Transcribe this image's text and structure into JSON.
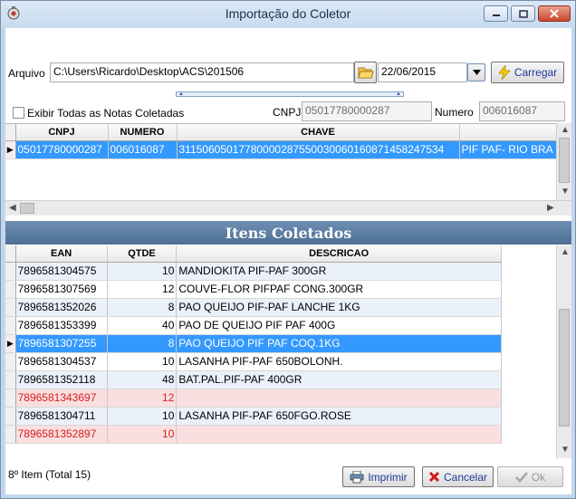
{
  "window": {
    "title": "Importação do Coletor"
  },
  "form": {
    "arquivo_label": "Arquivo",
    "arquivo_value": "C:\\Users\\Ricardo\\Desktop\\ACS\\201506",
    "date_value": "22/06/2015",
    "carregar_label": "Carregar",
    "exibir_label": "Exibir Todas as Notas Coletadas",
    "cnpj_label": "CNPJ",
    "cnpj_value": "05017780000287",
    "numero_label": "Numero",
    "numero_value": "006016087"
  },
  "notas_grid": {
    "columns": [
      "CNPJ",
      "NUMERO",
      "CHAVE",
      ""
    ],
    "rows": [
      [
        "05017780000287",
        "006016087",
        "31150605017780000287550030060160871458247534",
        "PIF PAF- RIO BRA"
      ]
    ]
  },
  "itens": {
    "header": "Itens Coletados",
    "columns": [
      "EAN",
      "QTDE",
      "DESCRICAO"
    ],
    "rows": [
      {
        "ean": "7896581304575",
        "qtde": "10",
        "desc": "MANDIOKITA PIF-PAF 300GR",
        "state": "blue"
      },
      {
        "ean": "7896581307569",
        "qtde": "12",
        "desc": "COUVE-FLOR PIFPAF CONG.300GR",
        "state": "white"
      },
      {
        "ean": "7896581352026",
        "qtde": "8",
        "desc": "PAO QUEIJO PIF-PAF LANCHE 1KG",
        "state": "blue"
      },
      {
        "ean": "7896581353399",
        "qtde": "40",
        "desc": "PAO DE QUEIJO PIF PAF 400G",
        "state": "white"
      },
      {
        "ean": "7896581307255",
        "qtde": "8",
        "desc": "PAO QUEIJO PIF PAF COQ.1KG",
        "state": "selected"
      },
      {
        "ean": "7896581304537",
        "qtde": "10",
        "desc": "LASANHA PIF-PAF 650BOLONH.",
        "state": "white"
      },
      {
        "ean": "7896581352118",
        "qtde": "48",
        "desc": "BAT.PAL.PIF-PAF 400GR",
        "state": "blue"
      },
      {
        "ean": "7896581343697",
        "qtde": "12",
        "desc": "",
        "state": "red"
      },
      {
        "ean": "7896581304711",
        "qtde": "10",
        "desc": "LASANHA PIF-PAF 650FGO.ROSE",
        "state": "blue"
      },
      {
        "ean": "7896581352897",
        "qtde": "10",
        "desc": "",
        "state": "red"
      }
    ]
  },
  "status": {
    "text": "8º Item (Total 15)"
  },
  "buttons": {
    "imprimir": "Imprimir",
    "cancelar": "Cancelar",
    "ok": "Ok"
  }
}
